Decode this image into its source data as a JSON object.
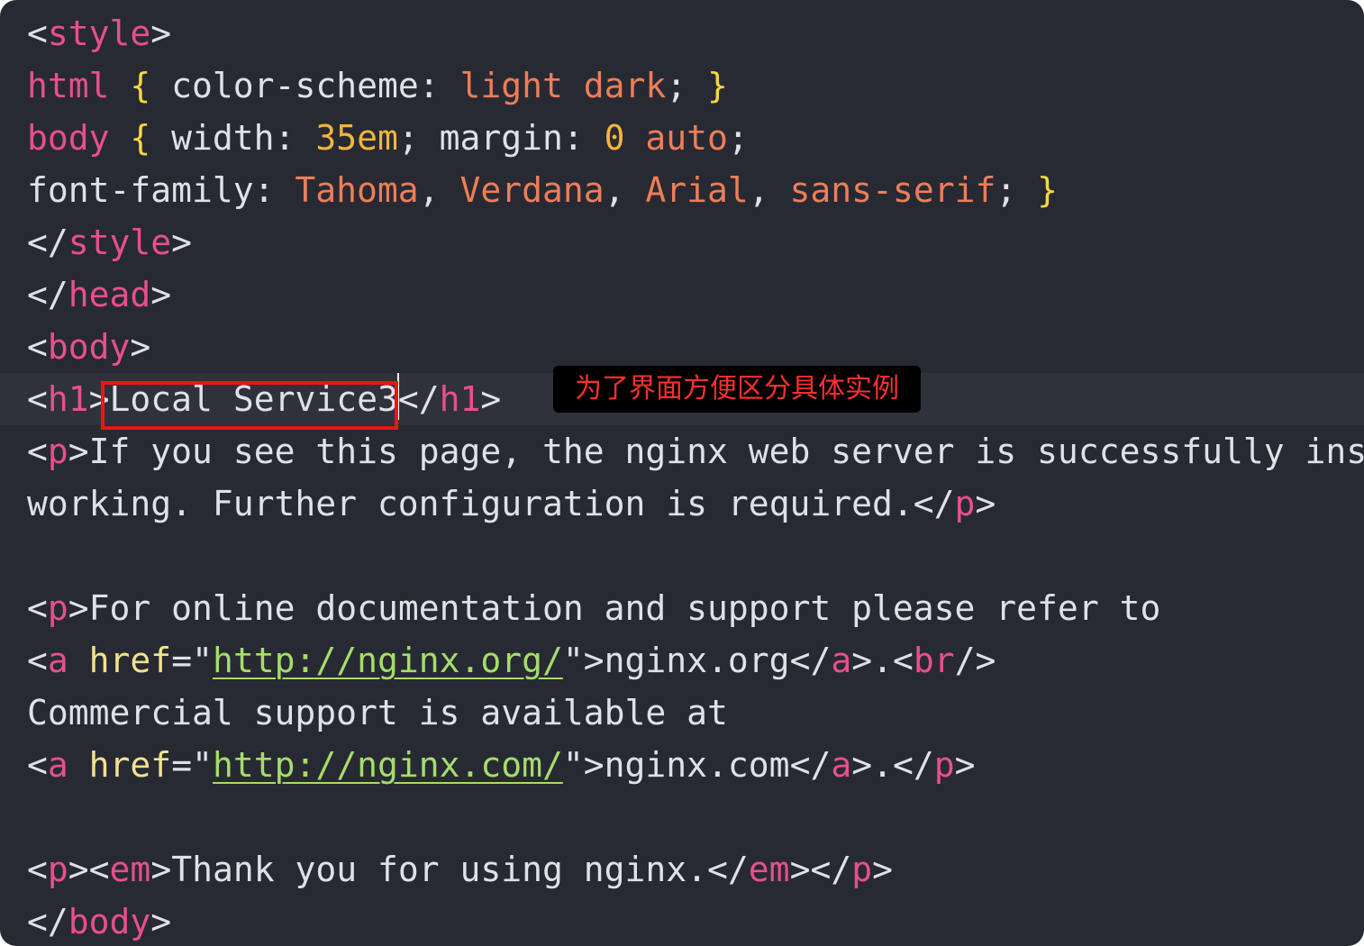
{
  "code_lines": [
    [
      {
        "t": "<",
        "c": "punct"
      },
      {
        "t": "style",
        "c": "tag"
      },
      {
        "t": ">",
        "c": "punct"
      }
    ],
    [
      {
        "t": "html",
        "c": "tag"
      },
      {
        "t": " ",
        "c": "text"
      },
      {
        "t": "{",
        "c": "brace"
      },
      {
        "t": " color-scheme: ",
        "c": "prop"
      },
      {
        "t": "light",
        "c": "str"
      },
      {
        "t": " ",
        "c": "text"
      },
      {
        "t": "dark",
        "c": "str"
      },
      {
        "t": "; ",
        "c": "punct"
      },
      {
        "t": "}",
        "c": "brace"
      }
    ],
    [
      {
        "t": "body",
        "c": "tag"
      },
      {
        "t": " ",
        "c": "text"
      },
      {
        "t": "{",
        "c": "brace"
      },
      {
        "t": " width: ",
        "c": "prop"
      },
      {
        "t": "35em",
        "c": "num"
      },
      {
        "t": "; margin: ",
        "c": "prop"
      },
      {
        "t": "0",
        "c": "num"
      },
      {
        "t": " ",
        "c": "text"
      },
      {
        "t": "auto",
        "c": "str"
      },
      {
        "t": ";",
        "c": "punct"
      }
    ],
    [
      {
        "t": "font-family: ",
        "c": "prop"
      },
      {
        "t": "Tahoma",
        "c": "str"
      },
      {
        "t": ", ",
        "c": "punct"
      },
      {
        "t": "Verdana",
        "c": "str"
      },
      {
        "t": ", ",
        "c": "punct"
      },
      {
        "t": "Arial",
        "c": "str"
      },
      {
        "t": ", ",
        "c": "punct"
      },
      {
        "t": "sans-serif",
        "c": "str"
      },
      {
        "t": "; ",
        "c": "punct"
      },
      {
        "t": "}",
        "c": "brace"
      }
    ],
    [
      {
        "t": "</",
        "c": "punct"
      },
      {
        "t": "style",
        "c": "tag"
      },
      {
        "t": ">",
        "c": "punct"
      }
    ],
    [
      {
        "t": "</",
        "c": "punct"
      },
      {
        "t": "head",
        "c": "tag"
      },
      {
        "t": ">",
        "c": "punct"
      }
    ],
    [
      {
        "t": "<",
        "c": "punct"
      },
      {
        "t": "body",
        "c": "tag"
      },
      {
        "t": ">",
        "c": "punct"
      }
    ],
    [
      {
        "t": "<",
        "c": "punct"
      },
      {
        "t": "h1",
        "c": "tag"
      },
      {
        "t": ">",
        "c": "punct"
      },
      {
        "t": "Local Service3",
        "c": "text"
      },
      {
        "t": "</",
        "c": "punct"
      },
      {
        "t": "h1",
        "c": "tag"
      },
      {
        "t": ">",
        "c": "punct"
      }
    ],
    [
      {
        "t": "<",
        "c": "punct"
      },
      {
        "t": "p",
        "c": "tag"
      },
      {
        "t": ">",
        "c": "punct"
      },
      {
        "t": "If you see this page, the nginx web server is successfully ins",
        "c": "text"
      }
    ],
    [
      {
        "t": "working. Further configuration is required.",
        "c": "text"
      },
      {
        "t": "</",
        "c": "punct"
      },
      {
        "t": "p",
        "c": "tag"
      },
      {
        "t": ">",
        "c": "punct"
      }
    ],
    [],
    [
      {
        "t": "<",
        "c": "punct"
      },
      {
        "t": "p",
        "c": "tag"
      },
      {
        "t": ">",
        "c": "punct"
      },
      {
        "t": "For online documentation and support please refer to",
        "c": "text"
      }
    ],
    [
      {
        "t": "<",
        "c": "punct"
      },
      {
        "t": "a",
        "c": "tag"
      },
      {
        "t": " ",
        "c": "text"
      },
      {
        "t": "href",
        "c": "attr"
      },
      {
        "t": "=\"",
        "c": "punct"
      },
      {
        "t": "http://nginx.org/",
        "c": "url"
      },
      {
        "t": "\">",
        "c": "punct"
      },
      {
        "t": "nginx.org",
        "c": "text"
      },
      {
        "t": "</",
        "c": "punct"
      },
      {
        "t": "a",
        "c": "tag"
      },
      {
        "t": ">.<",
        "c": "punct"
      },
      {
        "t": "br",
        "c": "tag"
      },
      {
        "t": "/>",
        "c": "punct"
      }
    ],
    [
      {
        "t": "Commercial support is available at",
        "c": "text"
      }
    ],
    [
      {
        "t": "<",
        "c": "punct"
      },
      {
        "t": "a",
        "c": "tag"
      },
      {
        "t": " ",
        "c": "text"
      },
      {
        "t": "href",
        "c": "attr"
      },
      {
        "t": "=\"",
        "c": "punct"
      },
      {
        "t": "http://nginx.com/",
        "c": "url"
      },
      {
        "t": "\">",
        "c": "punct"
      },
      {
        "t": "nginx.com",
        "c": "text"
      },
      {
        "t": "</",
        "c": "punct"
      },
      {
        "t": "a",
        "c": "tag"
      },
      {
        "t": ">.</",
        "c": "punct"
      },
      {
        "t": "p",
        "c": "tag"
      },
      {
        "t": ">",
        "c": "punct"
      }
    ],
    [],
    [
      {
        "t": "<",
        "c": "punct"
      },
      {
        "t": "p",
        "c": "tag"
      },
      {
        "t": "><",
        "c": "punct"
      },
      {
        "t": "em",
        "c": "tag"
      },
      {
        "t": ">",
        "c": "punct"
      },
      {
        "t": "Thank you for using nginx.",
        "c": "text"
      },
      {
        "t": "</",
        "c": "punct"
      },
      {
        "t": "em",
        "c": "tag"
      },
      {
        "t": "></",
        "c": "punct"
      },
      {
        "t": "p",
        "c": "tag"
      },
      {
        "t": ">",
        "c": "punct"
      }
    ],
    [
      {
        "t": "</",
        "c": "punct"
      },
      {
        "t": "body",
        "c": "tag"
      },
      {
        "t": ">",
        "c": "punct"
      }
    ]
  ],
  "active_line": 7,
  "annotation": {
    "text": "为了界面方便区分具体实例"
  },
  "colors": {
    "background": "#272a33",
    "tag": "#e84f8c",
    "string": "#ef7d57",
    "number": "#f4b43b",
    "brace": "#f7d83a",
    "attribute": "#f1e28d",
    "url": "#a6dc6b",
    "highlight_box": "#ec1515",
    "annotation_text": "#ff2f2f"
  }
}
